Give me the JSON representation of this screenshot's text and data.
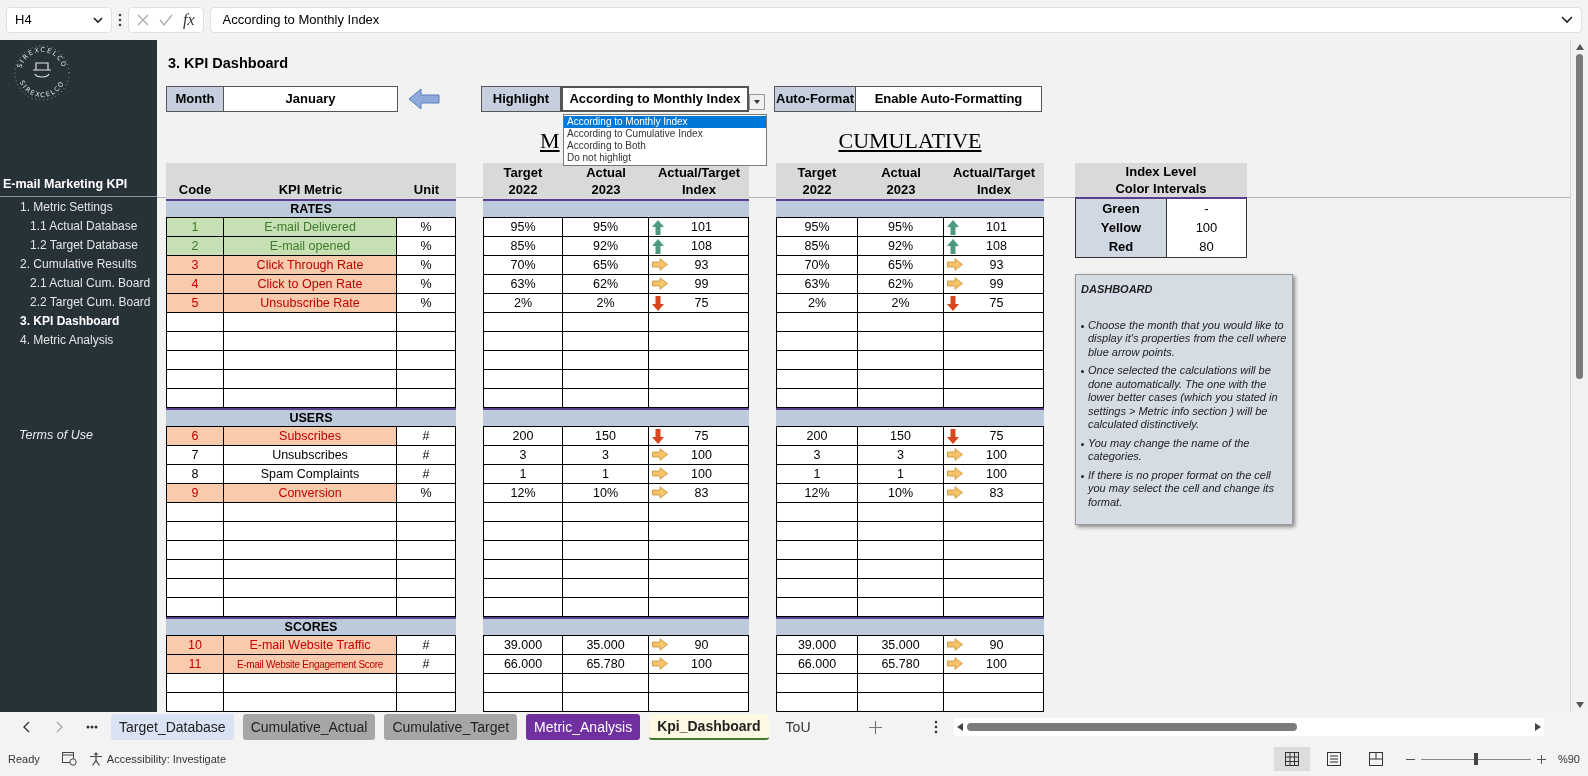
{
  "formula_bar": {
    "cell_ref": "H4",
    "function_label": "fx",
    "formula": "According to Monthly Index"
  },
  "sidebar": {
    "logo_text": [
      "SIREXCELCO",
      "SIREXCELCO"
    ],
    "title": "E-mail Marketing KPI",
    "items": [
      {
        "label": "1. Metric Settings",
        "selected": false,
        "children": [
          {
            "label": "1.1 Actual Database",
            "selected": false
          },
          {
            "label": "1.2 Target Database",
            "selected": false
          }
        ]
      },
      {
        "label": "2. Cumulative Results",
        "selected": false,
        "children": [
          {
            "label": "2.1 Actual Cum. Board",
            "selected": false
          },
          {
            "label": "2.2 Target Cum. Board",
            "selected": false
          }
        ]
      },
      {
        "label": "3. KPI Dashboard",
        "selected": true
      },
      {
        "label": "4. Metric Analysis",
        "selected": false
      }
    ],
    "footer_link": "Terms of Use"
  },
  "sheet_title": "3. KPI Dashboard",
  "month": {
    "label": "Month",
    "value": "January"
  },
  "highlight": {
    "label": "Highlight",
    "value": "According to Monthly Index",
    "expanded": true,
    "options": [
      {
        "label": "According to Monthly Index",
        "selected": true
      },
      {
        "label": "According to Cumulative Index",
        "selected": false
      },
      {
        "label": "According to Both",
        "selected": false
      },
      {
        "label": "Do not highligt",
        "selected": false
      }
    ]
  },
  "auto_format": {
    "label": "Auto-Format",
    "value": "Enable Auto-Formatting"
  },
  "monthly_heading": "M",
  "cumulative_heading": "CUMULATIVE",
  "metric_columns": [
    "Code",
    "KPI Metric",
    "Unit"
  ],
  "monthly_columns": [
    "Target\n2022",
    "Actual\n2023",
    "Actual/Target\nIndex"
  ],
  "cumulative_columns": [
    "Target\n2022",
    "Actual\n2023",
    "Actual/Target\nIndex"
  ],
  "sections": [
    {
      "title": "RATES",
      "rows": [
        {
          "code": "1",
          "metric": "E-mail Delivered",
          "unit": "%",
          "color": "#c6e0b4",
          "monthly": {
            "target": "95%",
            "actual": "95%",
            "kind": "up",
            "index": "101"
          },
          "cumulative": {
            "target": "95%",
            "actual": "95%",
            "kind": "up",
            "index": "101"
          }
        },
        {
          "code": "2",
          "metric": "E-mail opened",
          "unit": "%",
          "color": "#c6e0b4",
          "monthly": {
            "target": "85%",
            "actual": "92%",
            "kind": "up",
            "index": "108"
          },
          "cumulative": {
            "target": "85%",
            "actual": "92%",
            "kind": "up",
            "index": "108"
          }
        },
        {
          "code": "3",
          "metric": "Click Through Rate",
          "unit": "%",
          "color": "#f8cbad",
          "monthly": {
            "target": "70%",
            "actual": "65%",
            "kind": "right",
            "index": "93"
          },
          "cumulative": {
            "target": "70%",
            "actual": "65%",
            "kind": "right",
            "index": "93"
          }
        },
        {
          "code": "4",
          "metric": "Click to Open Rate",
          "unit": "%",
          "color": "#f8cbad",
          "monthly": {
            "target": "63%",
            "actual": "62%",
            "kind": "right",
            "index": "99"
          },
          "cumulative": {
            "target": "63%",
            "actual": "62%",
            "kind": "right",
            "index": "99"
          }
        },
        {
          "code": "5",
          "metric": "Unsubscribe Rate",
          "unit": "%",
          "color": "#f8cbad",
          "monthly": {
            "target": "2%",
            "actual": "2%",
            "kind": "down",
            "index": "75"
          },
          "cumulative": {
            "target": "2%",
            "actual": "2%",
            "kind": "down",
            "index": "75"
          }
        }
      ]
    },
    {
      "title": "USERS",
      "rows": [
        {
          "code": "6",
          "metric": "Subscribes",
          "unit": "#",
          "color": "#f8cbad",
          "monthly": {
            "target": "200",
            "actual": "150",
            "kind": "down",
            "index": "75"
          },
          "cumulative": {
            "target": "200",
            "actual": "150",
            "kind": "down",
            "index": "75"
          }
        },
        {
          "code": "7",
          "metric": "Unsubscribes",
          "unit": "#",
          "monthly": {
            "target": "3",
            "actual": "3",
            "kind": "right",
            "index": "100"
          },
          "cumulative": {
            "target": "3",
            "actual": "3",
            "kind": "right",
            "index": "100"
          }
        },
        {
          "code": "8",
          "metric": "Spam Complaints",
          "unit": "#",
          "monthly": {
            "target": "1",
            "actual": "1",
            "kind": "right",
            "index": "100"
          },
          "cumulative": {
            "target": "1",
            "actual": "1",
            "kind": "right",
            "index": "100"
          }
        },
        {
          "code": "9",
          "metric": "Conversion",
          "unit": "%",
          "color": "#f8cbad",
          "monthly": {
            "target": "12%",
            "actual": "10%",
            "kind": "right",
            "index": "83"
          },
          "cumulative": {
            "target": "12%",
            "actual": "10%",
            "kind": "right",
            "index": "83"
          }
        }
      ]
    },
    {
      "title": "SCORES",
      "rows": [
        {
          "code": "10",
          "metric": "E-mail Website Traffic",
          "unit": "#",
          "color": "#f8cbad",
          "monthly": {
            "target": "39.000",
            "actual": "35.000",
            "kind": "right",
            "index": "90"
          },
          "cumulative": {
            "target": "39.000",
            "actual": "35.000",
            "kind": "right",
            "index": "90"
          }
        },
        {
          "code": "11",
          "metric": "E-mail Website Engagement Score",
          "unit": "#",
          "color": "#f8cbad",
          "monthly": {
            "target": "66.000",
            "actual": "65.780",
            "kind": "right",
            "index": "100"
          },
          "cumulative": {
            "target": "66.000",
            "actual": "65.780",
            "kind": "right",
            "index": "100"
          }
        }
      ]
    }
  ],
  "index_levels": {
    "header": "Index Level\nColor Intervals",
    "rows": [
      {
        "label": "Green",
        "value": "-"
      },
      {
        "label": "Yellow",
        "value": "100"
      },
      {
        "label": "Red",
        "value": "80"
      }
    ]
  },
  "note": {
    "title": "DASHBOARD",
    "bullets": [
      "Choose the month that you would like to display it's properties from the cell where blue arrow points.",
      "Once selected the calculations will be done automatically. The one with the lower better cases (which you stated in settings > Metric info section ) will be calculated distinctively.",
      "You may change the name of the categories.",
      "If there is no proper format on the cell you may select the cell and change its format."
    ]
  },
  "sheet_tabs": [
    {
      "label": "Target_Database",
      "color": "#dae3f3",
      "selected": false
    },
    {
      "label": "Cumulative_Actual",
      "color": "#a6a6a6",
      "selected": false
    },
    {
      "label": "Cumulative_Target",
      "color": "#a6a6a6",
      "selected": false
    },
    {
      "label": "Metric_Analysis",
      "color": "#7030a0",
      "selected": false
    },
    {
      "label": "Kpi_Dashboard",
      "color": "#fdf8e4",
      "selected": true
    },
    {
      "label": "ToU",
      "selected": false
    }
  ],
  "status_bar": {
    "ready": "Ready",
    "accessibility": "Accessibility: Investigate",
    "views": [
      {
        "kind": "normal",
        "selected": true
      },
      {
        "kind": "page_layout",
        "selected": false
      },
      {
        "kind": "page_break",
        "selected": false
      }
    ],
    "zoom": {
      "level": 0.5,
      "label": "%90"
    }
  }
}
